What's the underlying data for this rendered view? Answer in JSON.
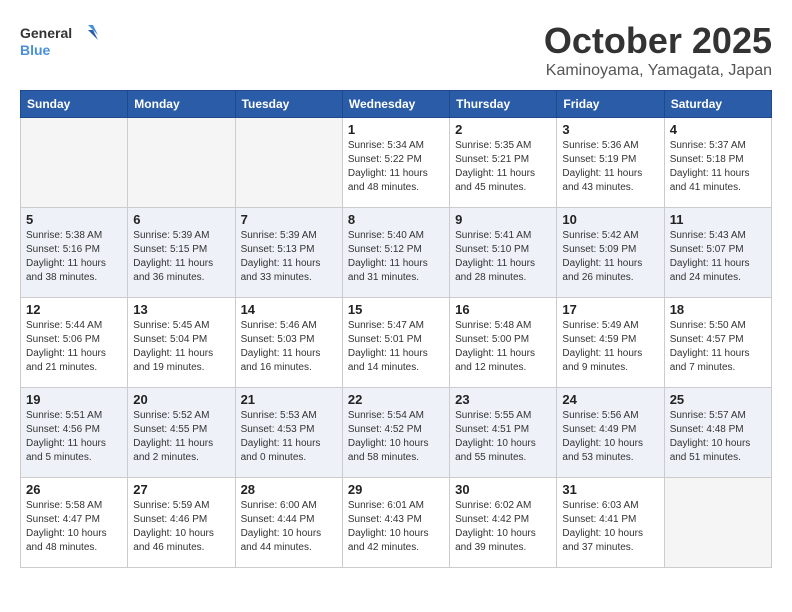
{
  "logo": {
    "line1": "General",
    "line2": "Blue"
  },
  "title": "October 2025",
  "location": "Kaminoyama, Yamagata, Japan",
  "headers": [
    "Sunday",
    "Monday",
    "Tuesday",
    "Wednesday",
    "Thursday",
    "Friday",
    "Saturday"
  ],
  "weeks": [
    [
      {
        "day": "",
        "info": ""
      },
      {
        "day": "",
        "info": ""
      },
      {
        "day": "",
        "info": ""
      },
      {
        "day": "1",
        "info": "Sunrise: 5:34 AM\nSunset: 5:22 PM\nDaylight: 11 hours and 48 minutes."
      },
      {
        "day": "2",
        "info": "Sunrise: 5:35 AM\nSunset: 5:21 PM\nDaylight: 11 hours and 45 minutes."
      },
      {
        "day": "3",
        "info": "Sunrise: 5:36 AM\nSunset: 5:19 PM\nDaylight: 11 hours and 43 minutes."
      },
      {
        "day": "4",
        "info": "Sunrise: 5:37 AM\nSunset: 5:18 PM\nDaylight: 11 hours and 41 minutes."
      }
    ],
    [
      {
        "day": "5",
        "info": "Sunrise: 5:38 AM\nSunset: 5:16 PM\nDaylight: 11 hours and 38 minutes."
      },
      {
        "day": "6",
        "info": "Sunrise: 5:39 AM\nSunset: 5:15 PM\nDaylight: 11 hours and 36 minutes."
      },
      {
        "day": "7",
        "info": "Sunrise: 5:39 AM\nSunset: 5:13 PM\nDaylight: 11 hours and 33 minutes."
      },
      {
        "day": "8",
        "info": "Sunrise: 5:40 AM\nSunset: 5:12 PM\nDaylight: 11 hours and 31 minutes."
      },
      {
        "day": "9",
        "info": "Sunrise: 5:41 AM\nSunset: 5:10 PM\nDaylight: 11 hours and 28 minutes."
      },
      {
        "day": "10",
        "info": "Sunrise: 5:42 AM\nSunset: 5:09 PM\nDaylight: 11 hours and 26 minutes."
      },
      {
        "day": "11",
        "info": "Sunrise: 5:43 AM\nSunset: 5:07 PM\nDaylight: 11 hours and 24 minutes."
      }
    ],
    [
      {
        "day": "12",
        "info": "Sunrise: 5:44 AM\nSunset: 5:06 PM\nDaylight: 11 hours and 21 minutes."
      },
      {
        "day": "13",
        "info": "Sunrise: 5:45 AM\nSunset: 5:04 PM\nDaylight: 11 hours and 19 minutes."
      },
      {
        "day": "14",
        "info": "Sunrise: 5:46 AM\nSunset: 5:03 PM\nDaylight: 11 hours and 16 minutes."
      },
      {
        "day": "15",
        "info": "Sunrise: 5:47 AM\nSunset: 5:01 PM\nDaylight: 11 hours and 14 minutes."
      },
      {
        "day": "16",
        "info": "Sunrise: 5:48 AM\nSunset: 5:00 PM\nDaylight: 11 hours and 12 minutes."
      },
      {
        "day": "17",
        "info": "Sunrise: 5:49 AM\nSunset: 4:59 PM\nDaylight: 11 hours and 9 minutes."
      },
      {
        "day": "18",
        "info": "Sunrise: 5:50 AM\nSunset: 4:57 PM\nDaylight: 11 hours and 7 minutes."
      }
    ],
    [
      {
        "day": "19",
        "info": "Sunrise: 5:51 AM\nSunset: 4:56 PM\nDaylight: 11 hours and 5 minutes."
      },
      {
        "day": "20",
        "info": "Sunrise: 5:52 AM\nSunset: 4:55 PM\nDaylight: 11 hours and 2 minutes."
      },
      {
        "day": "21",
        "info": "Sunrise: 5:53 AM\nSunset: 4:53 PM\nDaylight: 11 hours and 0 minutes."
      },
      {
        "day": "22",
        "info": "Sunrise: 5:54 AM\nSunset: 4:52 PM\nDaylight: 10 hours and 58 minutes."
      },
      {
        "day": "23",
        "info": "Sunrise: 5:55 AM\nSunset: 4:51 PM\nDaylight: 10 hours and 55 minutes."
      },
      {
        "day": "24",
        "info": "Sunrise: 5:56 AM\nSunset: 4:49 PM\nDaylight: 10 hours and 53 minutes."
      },
      {
        "day": "25",
        "info": "Sunrise: 5:57 AM\nSunset: 4:48 PM\nDaylight: 10 hours and 51 minutes."
      }
    ],
    [
      {
        "day": "26",
        "info": "Sunrise: 5:58 AM\nSunset: 4:47 PM\nDaylight: 10 hours and 48 minutes."
      },
      {
        "day": "27",
        "info": "Sunrise: 5:59 AM\nSunset: 4:46 PM\nDaylight: 10 hours and 46 minutes."
      },
      {
        "day": "28",
        "info": "Sunrise: 6:00 AM\nSunset: 4:44 PM\nDaylight: 10 hours and 44 minutes."
      },
      {
        "day": "29",
        "info": "Sunrise: 6:01 AM\nSunset: 4:43 PM\nDaylight: 10 hours and 42 minutes."
      },
      {
        "day": "30",
        "info": "Sunrise: 6:02 AM\nSunset: 4:42 PM\nDaylight: 10 hours and 39 minutes."
      },
      {
        "day": "31",
        "info": "Sunrise: 6:03 AM\nSunset: 4:41 PM\nDaylight: 10 hours and 37 minutes."
      },
      {
        "day": "",
        "info": ""
      }
    ]
  ]
}
